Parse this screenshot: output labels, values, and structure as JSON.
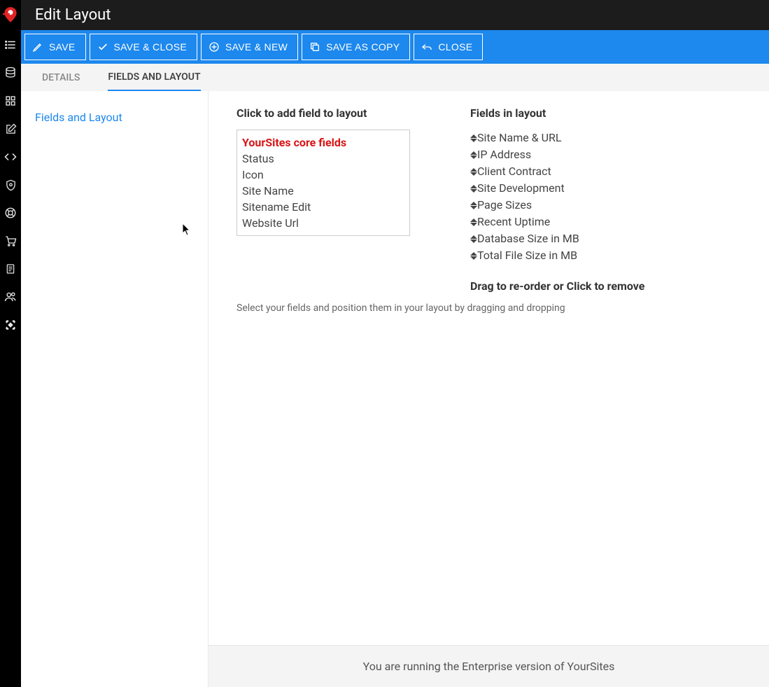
{
  "header": {
    "title": "Edit Layout"
  },
  "toolbar": {
    "save": "SAVE",
    "saveClose": "SAVE & CLOSE",
    "saveNew": "SAVE & NEW",
    "saveCopy": "SAVE AS COPY",
    "close": "CLOSE"
  },
  "tabs": {
    "details": "DETAILS",
    "fieldsLayout": "FIELDS AND LAYOUT"
  },
  "leftPane": {
    "sectionLabel": "Fields and Layout"
  },
  "available": {
    "title": "Click to add field to layout",
    "groupHeader": "YourSites core fields",
    "items": [
      "Status",
      "Icon",
      "Site Name",
      "Sitename Edit",
      "Website Url"
    ]
  },
  "layout": {
    "title": "Fields in layout",
    "items": [
      "Site Name & URL",
      "IP Address",
      "Client Contract",
      "Site Development",
      "Page Sizes",
      "Recent Uptime",
      "Database Size in MB",
      "Total File Size in MB"
    ],
    "dragHint": "Drag to re-order or Click to remove"
  },
  "helperText": "Select your fields and position them in your layout by dragging and dropping",
  "footer": "You are running the Enterprise version of YourSites",
  "icons": {
    "logo": "yoursites-logo",
    "nav": [
      "list",
      "database",
      "grid",
      "edit",
      "code",
      "shield",
      "life-ring",
      "cart",
      "document",
      "users",
      "joomla"
    ]
  }
}
